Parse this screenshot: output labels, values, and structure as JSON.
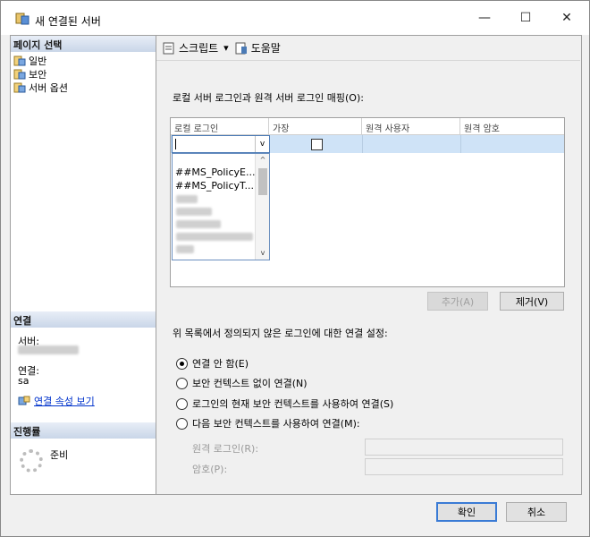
{
  "window": {
    "title": "새 연결된 서버",
    "minimize": "—",
    "maximize": "☐",
    "close": "✕"
  },
  "left_pane": {
    "page_select_header": "페이지 선택",
    "pages": [
      {
        "label": "일반",
        "icon": "page-icon"
      },
      {
        "label": "보안",
        "icon": "page-icon"
      },
      {
        "label": "서버 옵션",
        "icon": "page-icon"
      }
    ],
    "connection_header": "연결",
    "server_label": "서버:",
    "connection_label": "연결:",
    "connection_value": "sa",
    "view_properties_link": "연결 속성 보기",
    "progress_header": "진행률",
    "progress_status": "준비"
  },
  "toolbar": {
    "script_label": "스크립트",
    "script_dropdown": "▾",
    "help_label": "도움말"
  },
  "main": {
    "mapping_label": "로컬 서버 로그인과 원격 서버 로그인 매핑(O):",
    "grid_columns": [
      "로컬 로그인",
      "가장",
      "원격 사용자",
      "원격 암호"
    ],
    "dropdown_items": [
      "##MS_PolicyE...",
      "##MS_PolicyT..."
    ],
    "dropdown_up": "^",
    "dropdown_down": "v",
    "combo_arrow": "v",
    "add_button": "추가(A)",
    "remove_button": "제거(V)",
    "settings_label": "위 목록에서 정의되지 않은 로그인에 대한 연결 설정:",
    "options": [
      {
        "label": "연결 안 함(E)",
        "selected": true
      },
      {
        "label": "보안 컨텍스트 없이 연결(N)",
        "selected": false
      },
      {
        "label": "로그인의 현재 보안 컨텍스트를 사용하여 연결(S)",
        "selected": false
      },
      {
        "label": "다음 보안 컨텍스트를 사용하여 연결(M):",
        "selected": false
      }
    ],
    "remote_login_label": "원격 로그인(R):",
    "password_label": "암호(P):"
  },
  "footer": {
    "ok": "확인",
    "cancel": "취소"
  },
  "colors": {
    "selection_row": "#cfe3f7",
    "link": "#0033cc",
    "primary_border": "#3a7bd5"
  }
}
